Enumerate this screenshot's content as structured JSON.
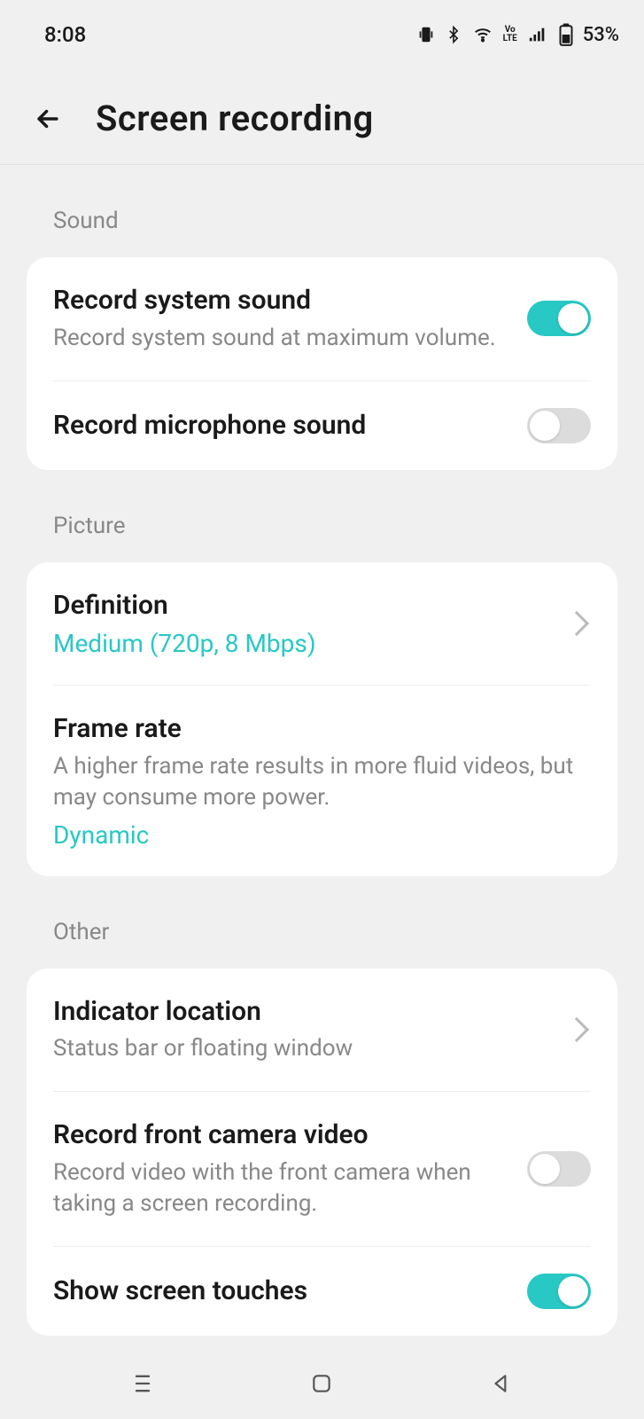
{
  "status": {
    "time": "8:08",
    "battery": "53%"
  },
  "header": {
    "title": "Screen recording"
  },
  "sections": {
    "sound": {
      "label": "Sound",
      "record_system": {
        "title": "Record system sound",
        "sub": "Record system sound at maximum volume.",
        "on": true
      },
      "record_mic": {
        "title": "Record microphone sound",
        "on": false
      }
    },
    "picture": {
      "label": "Picture",
      "definition": {
        "title": "Definition",
        "value": "Medium (720p, 8 Mbps)"
      },
      "frame_rate": {
        "title": "Frame rate",
        "sub": "A higher frame rate results in more fluid videos, but may consume more power.",
        "value": "Dynamic"
      }
    },
    "other": {
      "label": "Other",
      "indicator": {
        "title": "Indicator location",
        "sub": "Status bar or floating window"
      },
      "front_camera": {
        "title": "Record front camera video",
        "sub": "Record video with the front camera when taking a screen recording.",
        "on": false
      },
      "show_touches": {
        "title": "Show screen touches",
        "on": true
      }
    }
  }
}
